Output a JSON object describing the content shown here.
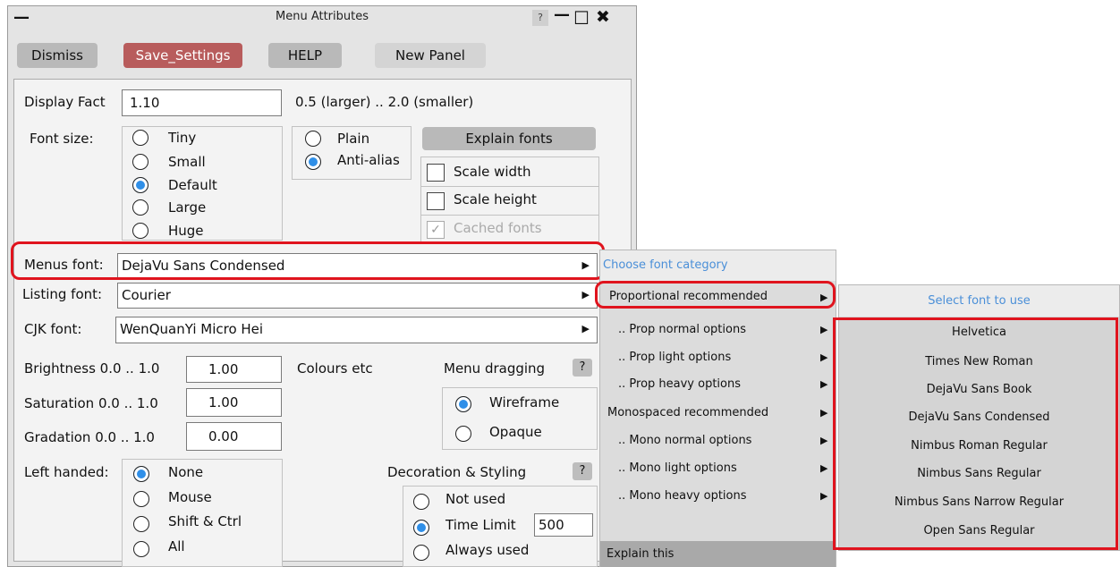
{
  "window": {
    "title": "Menu Attributes",
    "minimize_glyph": "—",
    "help_glyph": "?",
    "max_glyph": "—",
    "restore_glyph": "☐",
    "close_glyph": "✖"
  },
  "toolbar": {
    "dismiss": "Dismiss",
    "save_settings": "Save_Settings",
    "help": "HELP",
    "new_panel": "New Panel"
  },
  "display_factor": {
    "label": "Display Fact",
    "value": "1.10",
    "hint": "0.5 (larger) .. 2.0 (smaller)"
  },
  "font_size": {
    "label": "Font size:",
    "options": [
      "Tiny",
      "Small",
      "Default",
      "Large",
      "Huge"
    ],
    "selected": "Default"
  },
  "render": {
    "options": [
      "Plain",
      "Anti-alias"
    ],
    "selected": "Anti-alias"
  },
  "explain_fonts": "Explain fonts",
  "scale": {
    "width": "Scale width",
    "height": "Scale height",
    "cached": "Cached fonts"
  },
  "fonts": {
    "menus_label": "Menus font:",
    "menus_value": "DejaVu Sans  Condensed",
    "listing_label": "Listing font:",
    "listing_value": "Courier",
    "cjk_label": "CJK font:",
    "cjk_value": "WenQuanYi Micro Hei",
    "arrow": "▶"
  },
  "brightness": {
    "label": "Brightness 0.0 .. 1.0",
    "value": "1.00"
  },
  "saturation": {
    "label": "Saturation 0.0 .. 1.0",
    "value": "1.00"
  },
  "gradation": {
    "label": "Gradation  0.0 .. 1.0",
    "value": "0.00"
  },
  "colours_etc": "Colours etc",
  "menu_dragging": {
    "label": "Menu dragging",
    "help": "?",
    "options": [
      "Wireframe",
      "Opaque"
    ],
    "selected": "Wireframe"
  },
  "left_handed": {
    "label": "Left handed:",
    "options": [
      "None",
      "Mouse",
      "Shift & Ctrl",
      "All"
    ],
    "selected": "None"
  },
  "decoration": {
    "label": "Decoration & Styling",
    "help": "?",
    "options": [
      "Not used",
      "Time Limit",
      "Always used"
    ],
    "selected": "Time Limit",
    "time_limit_value": "500"
  },
  "category_menu": {
    "header": "Choose font category",
    "items": [
      "Proportional recommended",
      ".. Prop normal options",
      ".. Prop light options",
      ".. Prop heavy options",
      "Monospaced recommended",
      ".. Mono normal options",
      ".. Mono light options",
      ".. Mono heavy options"
    ],
    "explain": "Explain this",
    "arrow": "▶"
  },
  "font_menu": {
    "header": "Select font to use",
    "items": [
      "Helvetica",
      "Times New Roman",
      "DejaVu Sans  Book",
      "DejaVu Sans  Condensed",
      "Nimbus Roman  Regular",
      "Nimbus Sans  Regular",
      "Nimbus Sans Narrow  Regular",
      "Open Sans  Regular"
    ]
  },
  "colors": {
    "highlight_red": "#e0141e",
    "radio_selected": "#2f8fe8",
    "save_button": "#b85c5c",
    "menu_header_text": "#4a8fd8"
  }
}
